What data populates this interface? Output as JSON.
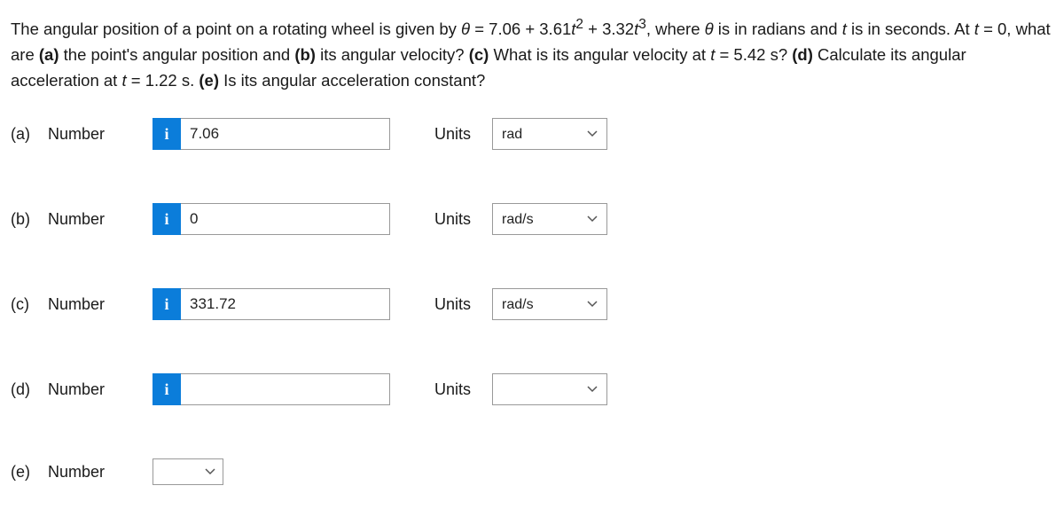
{
  "question": {
    "prefix": "The angular position of a point on a rotating wheel is given by ",
    "theta": "θ",
    "eq": " = 7.06 + 3.61",
    "t2": "t",
    "sup2": "2",
    "plus": " + 3.32",
    "t3": "t",
    "sup3": "3",
    "mid": ", where ",
    "theta2": "θ",
    "mid2": " is in radians and ",
    "tvar": "t",
    "mid3": " is in seconds. At ",
    "tvar2": "t",
    "mid4": " = 0, what are ",
    "pa": "(a)",
    "pa_text": " the point's angular position and ",
    "pb": "(b)",
    "pb_text": " its angular velocity? ",
    "pc": "(c)",
    "pc_text": " What is its angular velocity at ",
    "tvar3": "t",
    "pc_text2": " = 5.42 s? ",
    "pd": "(d)",
    "pd_text": " Calculate its angular acceleration at ",
    "tvar4": "t",
    "pd_text2": " = 1.22 s. ",
    "pe": "(e)",
    "pe_text": " Is its angular acceleration constant?"
  },
  "labels": {
    "number": "Number",
    "units": "Units",
    "info": "i"
  },
  "parts": {
    "a": {
      "letter": "(a)",
      "value": "7.06",
      "unit": "rad"
    },
    "b": {
      "letter": "(b)",
      "value": "0",
      "unit": "rad/s"
    },
    "c": {
      "letter": "(c)",
      "value": "331.72",
      "unit": "rad/s"
    },
    "d": {
      "letter": "(d)",
      "value": "",
      "unit": ""
    },
    "e": {
      "letter": "(e)",
      "value": ""
    }
  }
}
